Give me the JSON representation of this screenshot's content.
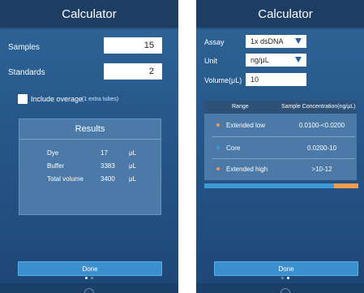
{
  "left_screen": {
    "title": "Calculator",
    "samples": {
      "label": "Samples",
      "value": "15"
    },
    "standards": {
      "label": "Standards",
      "value": "2"
    },
    "include_overage": {
      "label": "Include overage",
      "note": "(1 extra tubes)",
      "checked": false
    },
    "results": {
      "title": "Results",
      "rows": [
        {
          "name": "Dye",
          "value": "17",
          "unit": "μL"
        },
        {
          "name": "Buffer",
          "value": "3383",
          "unit": "μL"
        },
        {
          "name": "Total volume",
          "value": "3400",
          "unit": "μL"
        }
      ]
    },
    "done_label": "Done"
  },
  "right_screen": {
    "title": "Calculator",
    "assay": {
      "label": "Assay",
      "value": "1x dsDNA"
    },
    "unit": {
      "label": "Unit",
      "value": "ng/μL"
    },
    "volume": {
      "label": "Volume(μL)",
      "value": "10"
    },
    "table": {
      "headers": [
        "Range",
        "Sample Concentration(ng/μL)"
      ],
      "rows": [
        {
          "range": "Extended low",
          "value": "0.0100-<0.0200",
          "color": "#f29c4d"
        },
        {
          "range": "Core",
          "value": "0.0200-10",
          "color": "#3c9ad6"
        },
        {
          "range": "Extended high",
          "value": ">10-12",
          "color": "#f29c4d"
        }
      ]
    },
    "range_bar": {
      "core_fraction": 0.84,
      "colors": {
        "core": "#3c9ad6",
        "extended": "#f29c4d"
      }
    },
    "done_label": "Done"
  },
  "colors": {
    "accent": "#3a8fcf",
    "title_bar": "#1d3d63",
    "extended": "#f29c4d",
    "core": "#3c9ad6"
  }
}
